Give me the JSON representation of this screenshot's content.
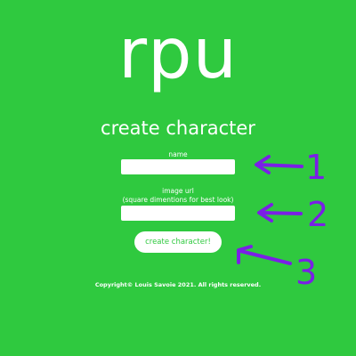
{
  "app": {
    "logo_text": "rpu",
    "title": "create character"
  },
  "form": {
    "name_label": "name",
    "name_value": "",
    "image_label_line1": "image url",
    "image_label_line2": "(square dimentions for best look)",
    "image_value": "",
    "submit_label": "create character!"
  },
  "footer": {
    "copyright": "Copyright© Louis Savoie 2021. All rights reserved."
  },
  "annotations": {
    "color": "#7a1fe6",
    "numbers": [
      "1",
      "2",
      "3"
    ]
  },
  "colors": {
    "background": "#2fc93f",
    "text": "#ffffff",
    "annotation": "#7a1fe6"
  }
}
